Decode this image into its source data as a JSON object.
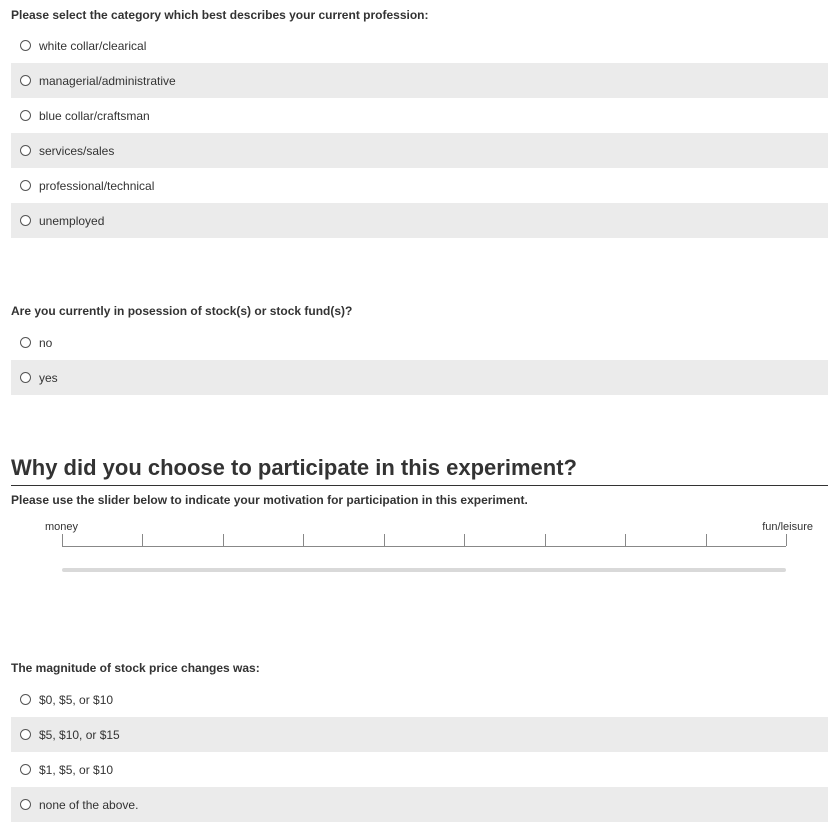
{
  "profession": {
    "question": "Please select the category which best describes your current profession:",
    "options": [
      "white collar/clearical",
      "managerial/administrative",
      "blue collar/craftsman",
      "services/sales",
      "professional/technical",
      "unemployed"
    ]
  },
  "stocks": {
    "question": "Are you currently in posession of stock(s) or stock fund(s)?",
    "options": [
      "no",
      "yes"
    ]
  },
  "motivation": {
    "title": "Why did you choose to participate in this experiment?",
    "question": "Please use the slider below to indicate your motivation for participation in this experiment.",
    "left_label": "money",
    "right_label": "fun/leisure",
    "tick_count": 10
  },
  "magnitude": {
    "question": "The magnitude of stock price changes was:",
    "options": [
      "$0, $5, or $10",
      "$5, $10, or $15",
      "$1, $5, or $10",
      "none of the above."
    ]
  },
  "colors": {
    "alt_row": "#ebebeb",
    "text": "#333333",
    "slider_track": "#d9d9d9"
  }
}
